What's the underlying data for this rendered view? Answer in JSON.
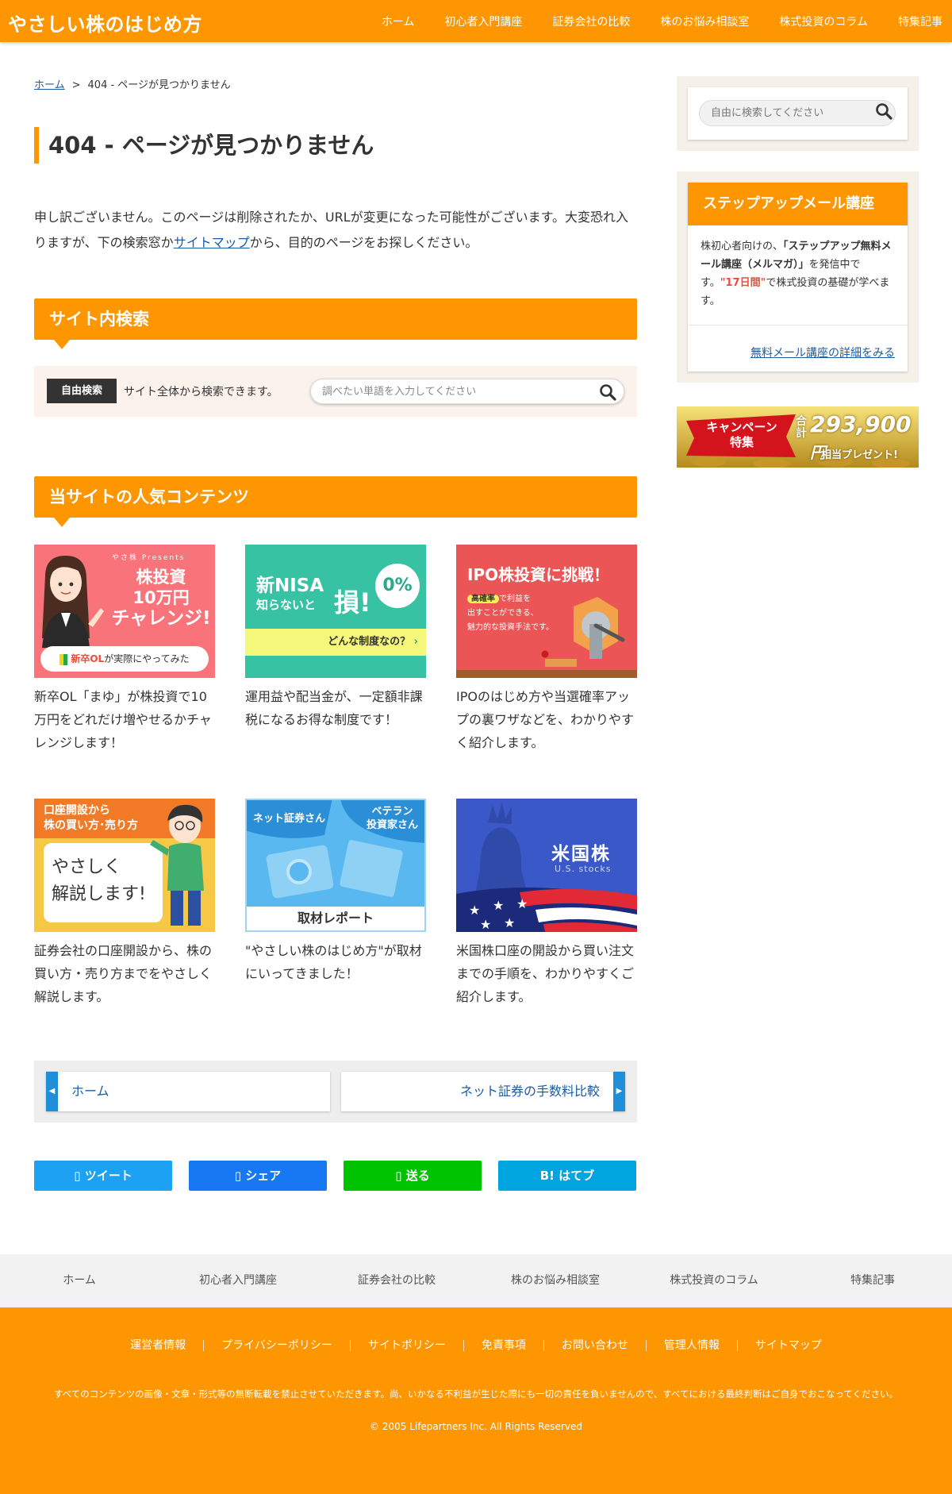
{
  "header": {
    "logo": "やさしい株のはじめ方",
    "nav": [
      "ホーム",
      "初心者入門講座",
      "証券会社の比較",
      "株のお悩み相談室",
      "株式投資のコラム",
      "特集記事"
    ]
  },
  "breadcrumb": {
    "home": "ホーム",
    "separator": ">",
    "current": "404 - ページが見つかりません"
  },
  "page_title": "404 - ページが見つかりません",
  "intro": {
    "before_link": "申し訳ございません。このページは削除されたか、URLが変更になった可能性がございます。大変恐れ入りますが、下の検索窓か",
    "link": "サイトマップ",
    "after_link": "から、目的のページをお探しください。"
  },
  "site_search": {
    "heading": "サイト内検索",
    "tag": "自由検索",
    "description": "サイト全体から検索できます。",
    "placeholder": "調べたい単語を入力してください"
  },
  "popular": {
    "heading": "当サイトの人気コンテンツ",
    "cards": [
      {
        "desc": "新卒OL「まゆ」が株投資で10万円をどれだけ増やせるかチャレンジします！",
        "img": {
          "brand": "やさ株 Presents",
          "title1": "株投資",
          "title2": "10万円",
          "title3": "チャレンジ!",
          "ribbon_b": "新卒OL",
          "ribbon_t": "が実際にやってみた"
        }
      },
      {
        "desc": "運用益や配当金が、一定額非課税になるお得な制度です！",
        "img": {
          "line1a": "新",
          "line1b": "NISA",
          "line2": "知らないと",
          "big": "損!",
          "badge": "0%",
          "bar": "どんな制度なの？"
        }
      },
      {
        "desc": "IPOのはじめ方や当選確率アップの裏ワザなどを、わかりやすく紹介します。",
        "img": {
          "title": "IPO株投資に挑戦！",
          "tag": "高確率",
          "t1": "で利益を",
          "t2": "出すことができる、",
          "t3": "魅力的な投資手法です。"
        }
      },
      {
        "desc": "証券会社の口座開設から、株の買い方・売り方までをやさしく解説します。",
        "img": {
          "top1": "口座開設から",
          "top2": "株の買い方･売り方",
          "mid1": "やさしく",
          "mid2": "解説します!"
        }
      },
      {
        "desc": "\"やさしい株のはじめ方\"が取材にいってきました！",
        "img": {
          "left": "ネット証券さん",
          "right1": "ベテラン",
          "right2": "投資家さん",
          "bottom": "取材レポート"
        }
      },
      {
        "desc": "米国株口座の開設から買い注文までの手順を、わかりやすくご紹介します。",
        "img": {
          "title": "米国株",
          "sub": "U.S. stocks"
        }
      }
    ]
  },
  "prev_next": {
    "prev": "ホーム",
    "next": "ネット証券の手数料比較"
  },
  "share": {
    "tweet": "ツイート",
    "facebook": "シェア",
    "line": "送る",
    "hatena": "B! はてブ"
  },
  "sidebar": {
    "search_placeholder": "自由に検索してください",
    "mail": {
      "heading": "ステップアップメール講座",
      "t1": "株初心者向けの、",
      "t2": "「ステップアップ無料メール講座（メルマガ）」",
      "t3": "を発信中です。",
      "t4": "\"17日間\"",
      "t5": "で株式投資の基礎が学べます。",
      "link": "無料メール講座の詳細をみる"
    },
    "banner": {
      "left1": "キャンペーン",
      "left2": "特集",
      "g1": "合",
      "g2": "計",
      "amount": "293,900",
      "yen": "円",
      "sub": "相当プレゼント!"
    }
  },
  "footer_nav": [
    "ホーム",
    "初心者入門講座",
    "証券会社の比較",
    "株のお悩み相談室",
    "株式投資のコラム",
    "特集記事"
  ],
  "footer": {
    "links": [
      "運営者情報",
      "プライバシーポリシー",
      "サイトポリシー",
      "免責事項",
      "お問い合わせ",
      "管理人情報",
      "サイトマップ"
    ],
    "notice": "すべてのコンテンツの画像・文章・形式等の無断転載を禁止させていただきます。尚、いかなる不利益が生じた際にも一切の責任を負いませんので、すべてにおける最終判断はご自身でおこなってください。",
    "copyright": "© 2005 Lifepartners Inc. All Rights Reserved"
  },
  "colors": {
    "brand": "#fd9600",
    "link": "#1a5da6",
    "twitter": "#1da1f2",
    "facebook": "#1877f2",
    "line": "#00c300",
    "hatena": "#00a4de"
  }
}
